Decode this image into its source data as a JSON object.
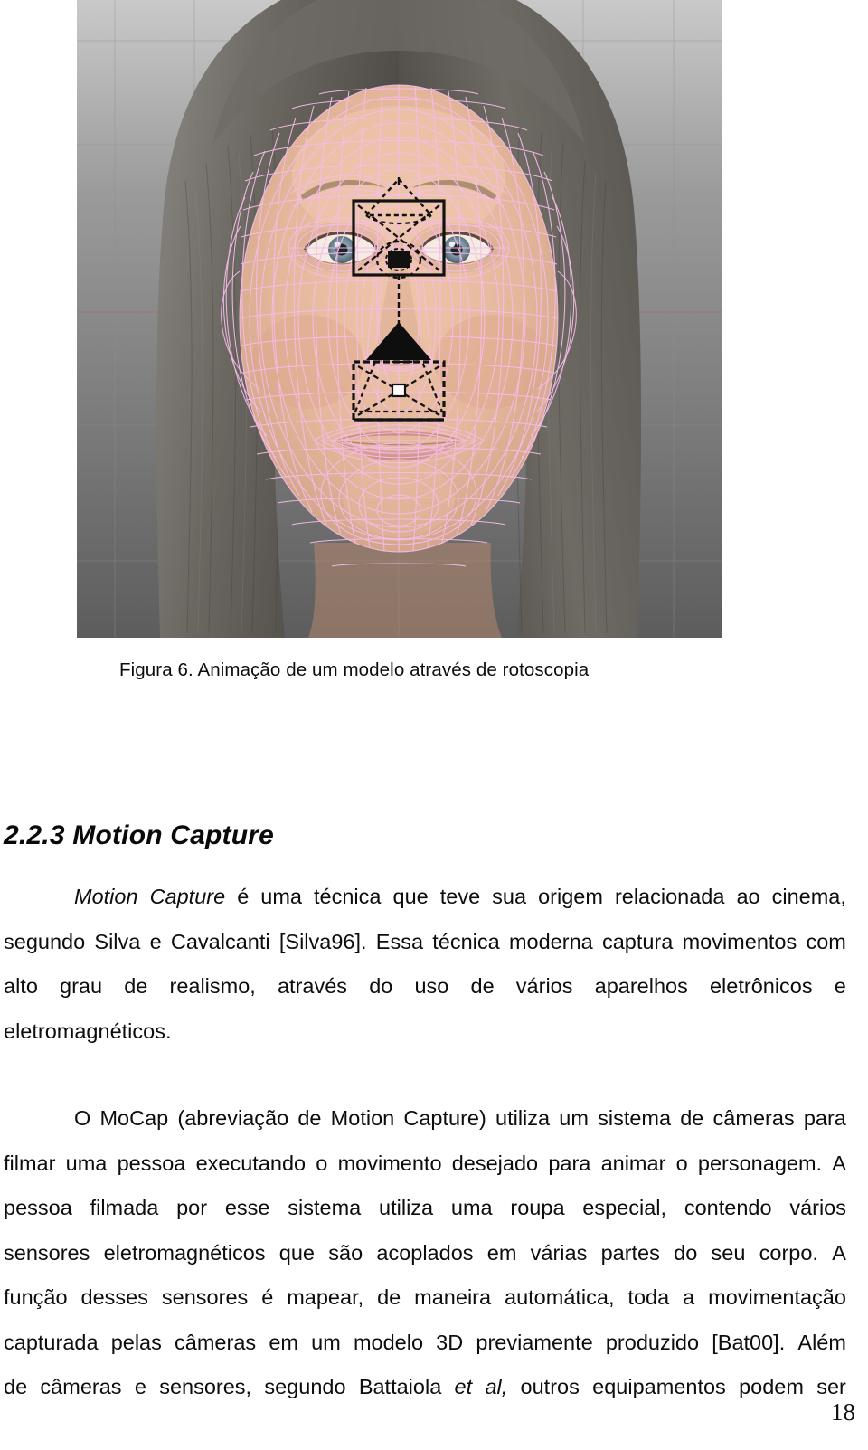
{
  "document": {
    "page_number": "18",
    "figure": {
      "caption": "Figura 6. Animação de um modelo através de rotoscopia",
      "alt_description": "Captura de tela de um software de modelagem 3D mostrando o rosto de uma mulher com uma malha wireframe rosa sobreposta e manipuladores 3D pretos",
      "colors": {
        "wireframe": "#f5b8e8",
        "gizmo": "#111111",
        "background": "#6e6e6e",
        "skin": "#e3b79c",
        "hair": "#5a544f",
        "iris": "#7d97a5",
        "lips": "#d79b95",
        "grid_line": "#8a8a8a",
        "axis_line": "#8a5a5a"
      }
    },
    "section": {
      "number_title": "2.2.3 Motion Capture"
    },
    "paragraphs": [
      {
        "id": "p1",
        "lines": [
          {
            "justified": true,
            "words": [
              "Motion",
              "Capture",
              "é",
              "uma",
              "técnica",
              "que",
              "teve",
              "sua",
              "origem",
              "relacionada",
              "ao",
              "cinema,"
            ],
            "italic_words": [
              0,
              1
            ],
            "indent": true
          },
          {
            "justified": true,
            "words": [
              "segundo",
              "Silva",
              "e",
              "Cavalcanti",
              "[Silva96].",
              "Essa",
              "técnica",
              "moderna",
              "captura",
              "movimentos",
              "com"
            ],
            "italic_words": [],
            "indent": false
          },
          {
            "justified": true,
            "words": [
              "alto",
              "grau",
              "de",
              "realismo,",
              "através",
              "do",
              "uso",
              "de",
              "vários",
              "aparelhos",
              "eletrônicos",
              "e"
            ],
            "italic_words": [],
            "indent": false
          },
          {
            "justified": false,
            "words": [
              "eletromagnéticos."
            ],
            "italic_words": [],
            "indent": false
          }
        ]
      },
      {
        "id": "p2",
        "lines": [
          {
            "justified": true,
            "words": [
              "O",
              "MoCap",
              "(abreviação",
              "de",
              "Motion",
              "Capture)",
              "utiliza",
              "um",
              "sistema",
              "de",
              "câmeras",
              "para"
            ],
            "italic_words": [],
            "indent": true
          },
          {
            "justified": true,
            "words": [
              "filmar",
              "uma",
              "pessoa",
              "executando",
              "o",
              "movimento",
              "desejado",
              "para",
              "animar",
              "o",
              "personagem.",
              "A"
            ],
            "italic_words": [],
            "indent": false
          },
          {
            "justified": true,
            "words": [
              "pessoa",
              "filmada",
              "por",
              "esse",
              "sistema",
              "utiliza",
              "uma",
              "roupa",
              "especial,",
              "contendo",
              "vários"
            ],
            "italic_words": [],
            "indent": false
          },
          {
            "justified": true,
            "words": [
              "sensores",
              "eletromagnéticos",
              "que",
              "são",
              "acoplados",
              "em",
              "várias",
              "partes",
              "do",
              "seu",
              "corpo.",
              "A"
            ],
            "italic_words": [],
            "indent": false
          },
          {
            "justified": true,
            "words": [
              "função",
              "desses",
              "sensores",
              "é",
              "mapear,",
              "de",
              "maneira",
              "automática,",
              "toda",
              "a",
              "movimentação"
            ],
            "italic_words": [],
            "indent": false
          },
          {
            "justified": true,
            "words": [
              "capturada",
              "pelas",
              "câmeras",
              "em",
              "um",
              "modelo",
              "3D",
              "previamente",
              "produzido",
              "[Bat00].",
              "Além"
            ],
            "italic_words": [],
            "indent": false
          },
          {
            "justified": true,
            "words": [
              "de",
              "câmeras",
              "e",
              "sensores,",
              "segundo",
              "Battaiola",
              "et",
              "al,",
              "outros",
              "equipamentos",
              "podem",
              "ser"
            ],
            "italic_words": [
              6,
              7
            ],
            "indent": false
          }
        ]
      }
    ]
  }
}
